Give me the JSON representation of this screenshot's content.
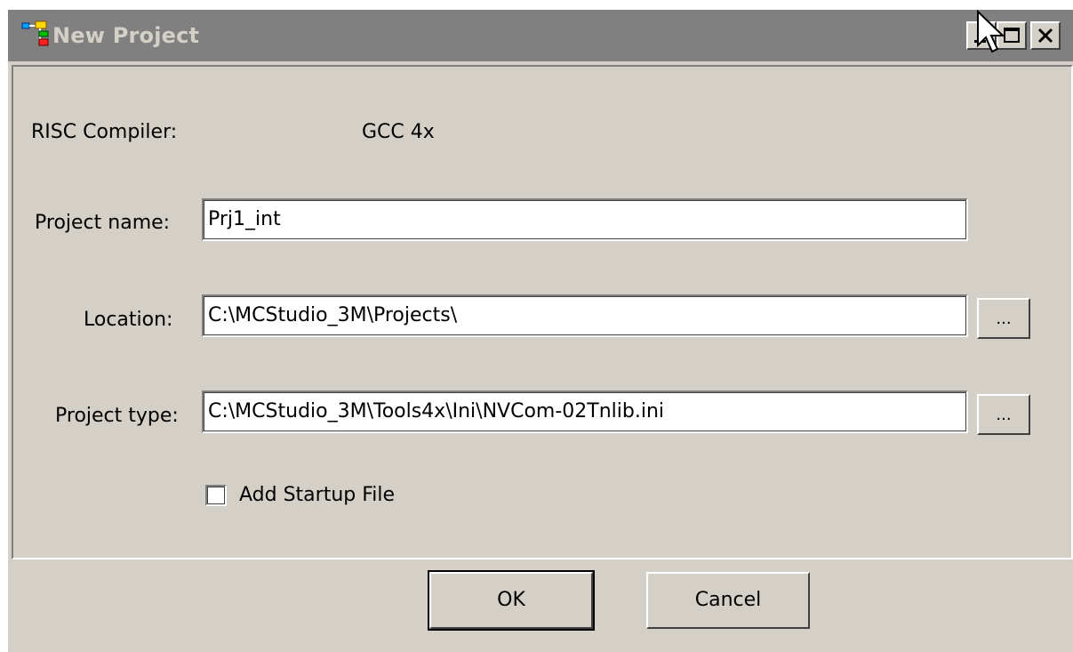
{
  "window": {
    "title": "New Project",
    "controls": [
      "minimize",
      "maximize",
      "close"
    ]
  },
  "form": {
    "compiler_label": "RISC Compiler:",
    "compiler_value": "GCC 4x",
    "project_name_label": "Project name:",
    "project_name_value": "Prj1_int",
    "location_label": "Location:",
    "location_value": "C:\\MCStudio_3M\\Projects\\",
    "location_browse_label": "...",
    "project_type_label": "Project type:",
    "project_type_value": "C:\\MCStudio_3M\\Tools4x\\Ini\\NVCom-02Tnlib.ini",
    "project_type_browse_label": "...",
    "startup_file_label": "Add Startup File",
    "startup_file_checked": false
  },
  "buttons": {
    "ok_label": "OK",
    "cancel_label": "Cancel"
  },
  "colors": {
    "window_bg": "#d4d0c8",
    "titlebar_bg": "#808080",
    "title_text": "#d4d0c8"
  },
  "icons": {
    "app": "project-tree-icon",
    "minimize": "minimize-icon",
    "maximize": "maximize-icon",
    "close": "close-icon",
    "cursor": "mouse-pointer-icon"
  }
}
